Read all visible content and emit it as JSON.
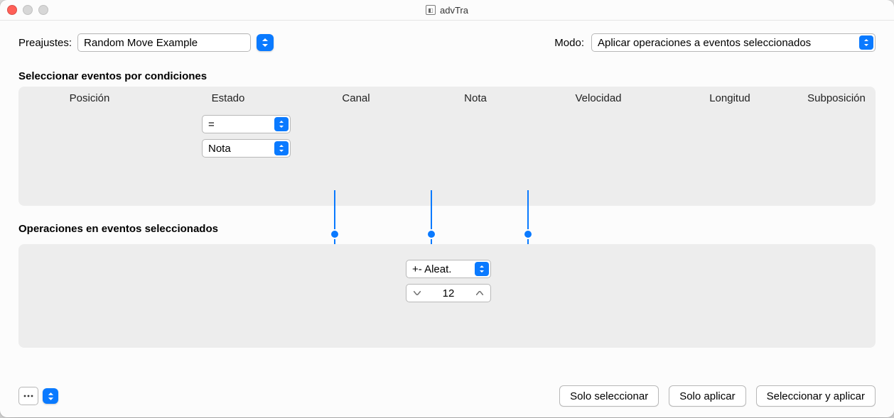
{
  "window": {
    "title": "advTra"
  },
  "top": {
    "presets_label": "Preajustes:",
    "preset_value": "Random Move Example",
    "mode_label": "Modo:",
    "mode_value": "Aplicar operaciones a eventos seleccionados"
  },
  "conditions": {
    "title": "Seleccionar eventos por condiciones",
    "columns": [
      "Posición",
      "Estado",
      "Canal",
      "Nota",
      "Velocidad",
      "Longitud",
      "Subposición"
    ],
    "estado_op": "=",
    "estado_val": "Nota"
  },
  "operations": {
    "title": "Operaciones en eventos seleccionados",
    "op_value": "+- Aleat.",
    "amount": "12"
  },
  "footer": {
    "select_only": "Solo seleccionar",
    "apply_only": "Solo aplicar",
    "select_and_apply": "Seleccionar y aplicar"
  }
}
